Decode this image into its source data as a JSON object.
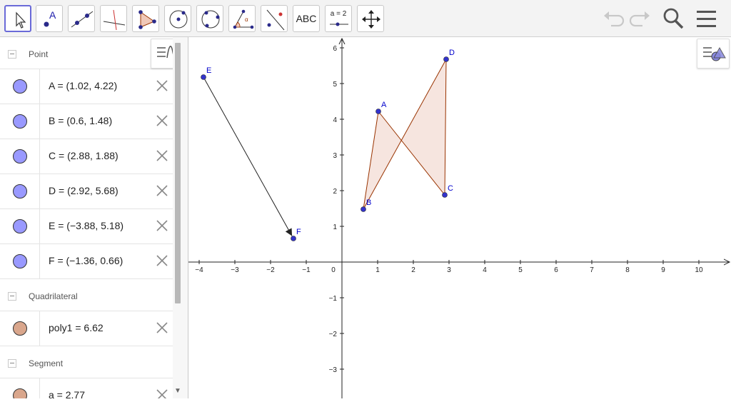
{
  "toolbar": {
    "tools": [
      {
        "id": "move",
        "name": "move-tool"
      },
      {
        "id": "point",
        "name": "point-tool",
        "label": "A"
      },
      {
        "id": "line",
        "name": "line-tool"
      },
      {
        "id": "perpendicular",
        "name": "perpendicular-line-tool"
      },
      {
        "id": "polygon",
        "name": "polygon-tool"
      },
      {
        "id": "circle-center",
        "name": "circle-center-point-tool"
      },
      {
        "id": "circle-three",
        "name": "circle-three-points-tool"
      },
      {
        "id": "angle",
        "name": "angle-tool"
      },
      {
        "id": "reflect",
        "name": "reflect-tool"
      },
      {
        "id": "text",
        "name": "text-tool",
        "label": "ABC"
      },
      {
        "id": "slider",
        "name": "slider-tool",
        "label": "a = 2"
      },
      {
        "id": "move-graphics",
        "name": "move-graphics-view-tool"
      }
    ]
  },
  "algebra": {
    "categories": [
      {
        "label": "Point",
        "items": [
          {
            "text": "A = (1.02, 4.22)",
            "color": "#9999ff"
          },
          {
            "text": "B = (0.6, 1.48)",
            "color": "#9999ff"
          },
          {
            "text": "C = (2.88, 1.88)",
            "color": "#9999ff"
          },
          {
            "text": "D = (2.92, 5.68)",
            "color": "#9999ff"
          },
          {
            "text": "E = (-3.88, 5.18)",
            "color": "#9999ff"
          },
          {
            "text": "F = (-1.36, 0.66)",
            "color": "#9999ff"
          }
        ]
      },
      {
        "label": "Quadrilateral",
        "items": [
          {
            "text": "poly1 = 6.62",
            "color": "#d9a68c"
          }
        ]
      },
      {
        "label": "Segment",
        "items": [
          {
            "text": "a = 2.77",
            "color": "#d9a68c"
          }
        ]
      }
    ]
  },
  "graphics": {
    "x_ticks": [
      -4,
      -3,
      -2,
      -1,
      0,
      1,
      2,
      3,
      4,
      5,
      6,
      7,
      8,
      9,
      10
    ],
    "y_ticks": [
      -3,
      -2,
      -1,
      1,
      2,
      3,
      4,
      5,
      6
    ],
    "points": [
      {
        "label": "A",
        "x": 1.02,
        "y": 4.22
      },
      {
        "label": "B",
        "x": 0.6,
        "y": 1.48
      },
      {
        "label": "C",
        "x": 2.88,
        "y": 1.88
      },
      {
        "label": "D",
        "x": 2.92,
        "y": 5.68
      },
      {
        "label": "E",
        "x": -3.88,
        "y": 5.18
      },
      {
        "label": "F",
        "x": -1.36,
        "y": 0.66
      }
    ],
    "polygon": [
      "A",
      "C",
      "D",
      "B"
    ],
    "vector": {
      "from": "E",
      "to": "F"
    },
    "colors": {
      "point": "#3333cc",
      "polygon_fill": "#f4e1d9",
      "polygon_stroke": "#993300",
      "label": "#0000cc",
      "axis": "#222222"
    }
  }
}
